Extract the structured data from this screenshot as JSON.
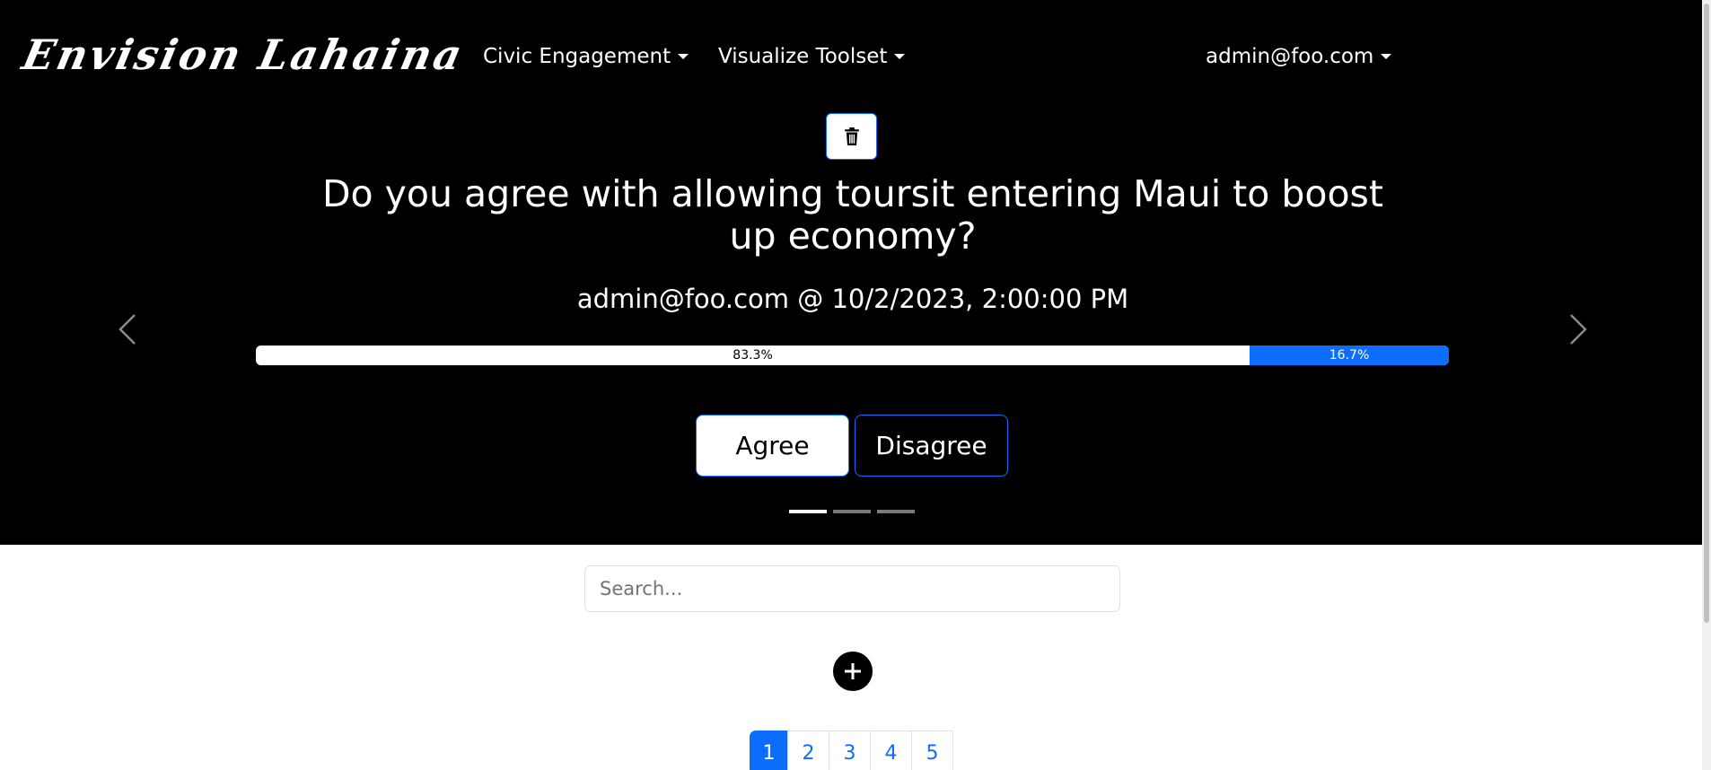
{
  "brand": {
    "name": "Envision Lahaina"
  },
  "nav": {
    "civic_engagement": "Civic Engagement",
    "visualize_toolset": "Visualize Toolset",
    "user_menu": "admin@foo.com"
  },
  "carousel": {
    "question": "Do you agree with allowing toursit entering Maui to boost up economy?",
    "byline": "admin@foo.com @ 10/2/2023, 2:00:00 PM",
    "results": {
      "agree_percent": 83.3,
      "disagree_percent": 16.7,
      "agree_label": "83.3%",
      "disagree_label": "16.7%"
    },
    "buttons": {
      "agree": "Agree",
      "disagree": "Disagree"
    },
    "indicators": {
      "count": 3,
      "active": 0
    },
    "icons": {
      "delete": "trash-icon",
      "prev": "chevron-left-icon",
      "next": "chevron-right-icon"
    }
  },
  "search": {
    "placeholder": "Search...",
    "value": ""
  },
  "add": {
    "icon": "plus-icon"
  },
  "pagination": {
    "pages": [
      "1",
      "2",
      "3",
      "4",
      "5"
    ],
    "active": "1"
  },
  "colors": {
    "primary": "#0d6efd",
    "hero_bg": "#000000",
    "text_light": "#ffffff"
  }
}
